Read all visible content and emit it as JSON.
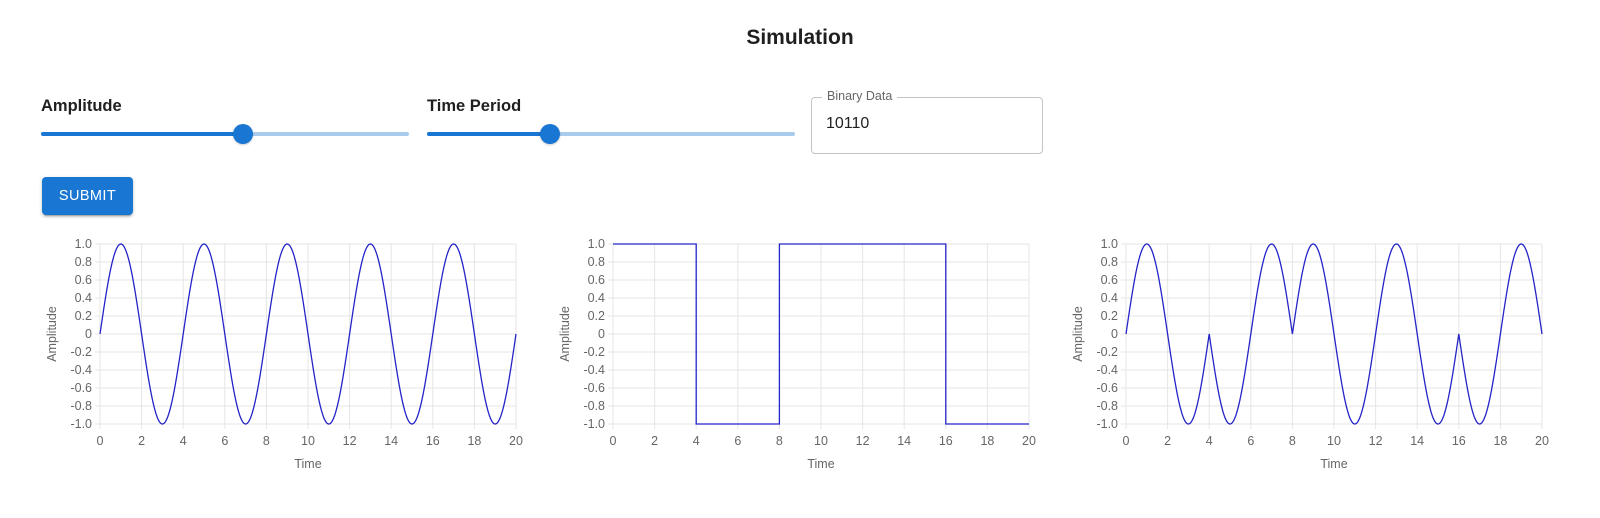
{
  "page_title": "Simulation",
  "controls": {
    "amplitude": {
      "label": "Amplitude",
      "value_fraction": 0.55
    },
    "time_period": {
      "label": "Time Period",
      "value_fraction": 0.335
    },
    "binary_data": {
      "label": "Binary Data",
      "value": "10110"
    },
    "submit_label": "SUBMIT"
  },
  "colors": {
    "accent": "#1976d2",
    "line": "#2424c8",
    "grid": "#e5e5e5"
  },
  "chart_data": [
    {
      "type": "line",
      "series": [
        {
          "function": "sin(2*pi*t/4)",
          "t_range": [
            0,
            20
          ]
        }
      ],
      "xlabel": "Time",
      "ylabel": "Amplitude",
      "xlim": [
        0,
        20
      ],
      "ylim": [
        -1,
        1
      ],
      "x_ticks": [
        "0",
        "2",
        "4",
        "6",
        "8",
        "10",
        "12",
        "14",
        "16",
        "18",
        "20"
      ],
      "y_ticks": [
        "1.0",
        "0.8",
        "0.6",
        "0.4",
        "0.2",
        "0",
        "-0.2",
        "-0.4",
        "-0.6",
        "-0.8",
        "-1.0"
      ],
      "grid": true
    },
    {
      "type": "line",
      "series": [
        {
          "step": true,
          "x": [
            0,
            4,
            4,
            8,
            8,
            16,
            16,
            20
          ],
          "y": [
            1,
            1,
            -1,
            -1,
            1,
            1,
            -1,
            -1
          ]
        }
      ],
      "xlabel": "Time",
      "ylabel": "Amplitude",
      "xlim": [
        0,
        20
      ],
      "ylim": [
        -1,
        1
      ],
      "x_ticks": [
        "0",
        "2",
        "4",
        "6",
        "8",
        "10",
        "12",
        "14",
        "16",
        "18",
        "20"
      ],
      "y_ticks": [
        "1.0",
        "0.8",
        "0.6",
        "0.4",
        "0.2",
        "0",
        "-0.2",
        "-0.4",
        "-0.6",
        "-0.8",
        "-1.0"
      ],
      "grid": true
    },
    {
      "type": "line",
      "series": [
        {
          "function": "sign_segments * sin(2*pi*t/4)",
          "bit_boundaries": [
            0,
            4,
            8,
            12,
            16,
            20
          ],
          "segment_signs": [
            1,
            -1,
            1,
            1,
            -1
          ],
          "t_range": [
            0,
            20
          ]
        }
      ],
      "xlabel": "Time",
      "ylabel": "Amplitude",
      "xlim": [
        0,
        20
      ],
      "ylim": [
        -1,
        1
      ],
      "x_ticks": [
        "0",
        "2",
        "4",
        "6",
        "8",
        "10",
        "12",
        "14",
        "16",
        "18",
        "20"
      ],
      "y_ticks": [
        "1.0",
        "0.8",
        "0.6",
        "0.4",
        "0.2",
        "0",
        "-0.2",
        "-0.4",
        "-0.6",
        "-0.8",
        "-1.0"
      ],
      "grid": true
    }
  ]
}
